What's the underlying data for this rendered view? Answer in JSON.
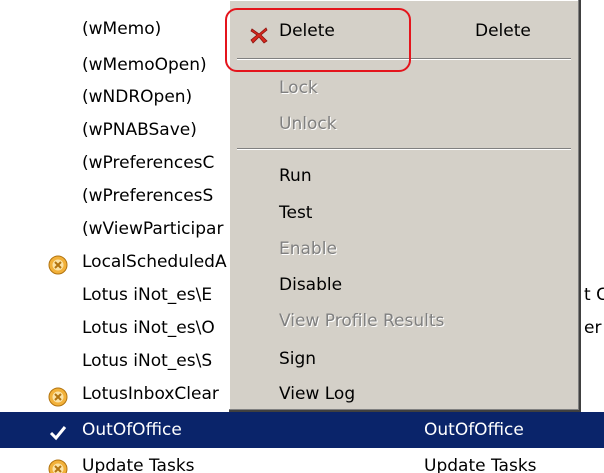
{
  "agent_list": {
    "rows": [
      {
        "name": "(wMemo)",
        "alias": "",
        "extra": "",
        "icon": "none",
        "selected": false
      },
      {
        "name": "(wMemoOpen)",
        "alias": "",
        "extra": "",
        "icon": "none",
        "selected": false
      },
      {
        "name": "(wNDROpen)",
        "alias": "",
        "extra": "",
        "icon": "none",
        "selected": false
      },
      {
        "name": "(wPNABSave)",
        "alias": "",
        "extra": "",
        "icon": "none",
        "selected": false
      },
      {
        "name": "(wPreferencesC",
        "alias": "",
        "extra": "",
        "icon": "none",
        "selected": false
      },
      {
        "name": "(wPreferencesS",
        "alias": "",
        "extra": "",
        "icon": "none",
        "selected": false
      },
      {
        "name": "(wViewParticipar",
        "alias": "",
        "extra": "",
        "icon": "none",
        "selected": false
      },
      {
        "name": "LocalScheduledA",
        "alias": "",
        "extra": "",
        "icon": "disabled-agent-icon",
        "selected": false
      },
      {
        "name": "Lotus iNot_es\\E",
        "alias": "",
        "extra": "t C",
        "icon": "none",
        "selected": false
      },
      {
        "name": "Lotus iNot_es\\O",
        "alias": "",
        "extra": "er",
        "icon": "none",
        "selected": false
      },
      {
        "name": "Lotus iNot_es\\S",
        "alias": "",
        "extra": "",
        "icon": "none",
        "selected": false
      },
      {
        "name": "LotusInboxClear",
        "alias": "",
        "extra": "",
        "icon": "disabled-agent-icon",
        "selected": false
      },
      {
        "name": "OutOfOffice",
        "alias": "OutOfOffice",
        "extra": "",
        "icon": "checkmark-icon",
        "selected": true
      },
      {
        "name": "Update Tasks",
        "alias": "Update Tasks",
        "extra": "",
        "icon": "disabled-agent-icon",
        "selected": false
      }
    ]
  },
  "context_menu": {
    "items": [
      {
        "label": "Delete",
        "shortcut": "Delete",
        "disabled": false,
        "icon": "delete-x-icon"
      },
      {
        "label": "Lock",
        "shortcut": "",
        "disabled": true,
        "icon": "none"
      },
      {
        "label": "Unlock",
        "shortcut": "",
        "disabled": true,
        "icon": "none"
      },
      {
        "label": "Run",
        "shortcut": "",
        "disabled": false,
        "icon": "none"
      },
      {
        "label": "Test",
        "shortcut": "",
        "disabled": false,
        "icon": "none"
      },
      {
        "label": "Enable",
        "shortcut": "",
        "disabled": true,
        "icon": "none"
      },
      {
        "label": "Disable",
        "shortcut": "",
        "disabled": false,
        "icon": "none"
      },
      {
        "label": "View Profile Results",
        "shortcut": "",
        "disabled": true,
        "icon": "none"
      },
      {
        "label": "Sign",
        "shortcut": "",
        "disabled": false,
        "icon": "none"
      },
      {
        "label": "View Log",
        "shortcut": "",
        "disabled": false,
        "icon": "none"
      }
    ]
  },
  "colors": {
    "selection": "#0a246a",
    "menu_background": "#d4d0c8",
    "disabled_text": "#808080",
    "highlight_ring": "#e4141c",
    "delete_icon": "#d9281e"
  }
}
